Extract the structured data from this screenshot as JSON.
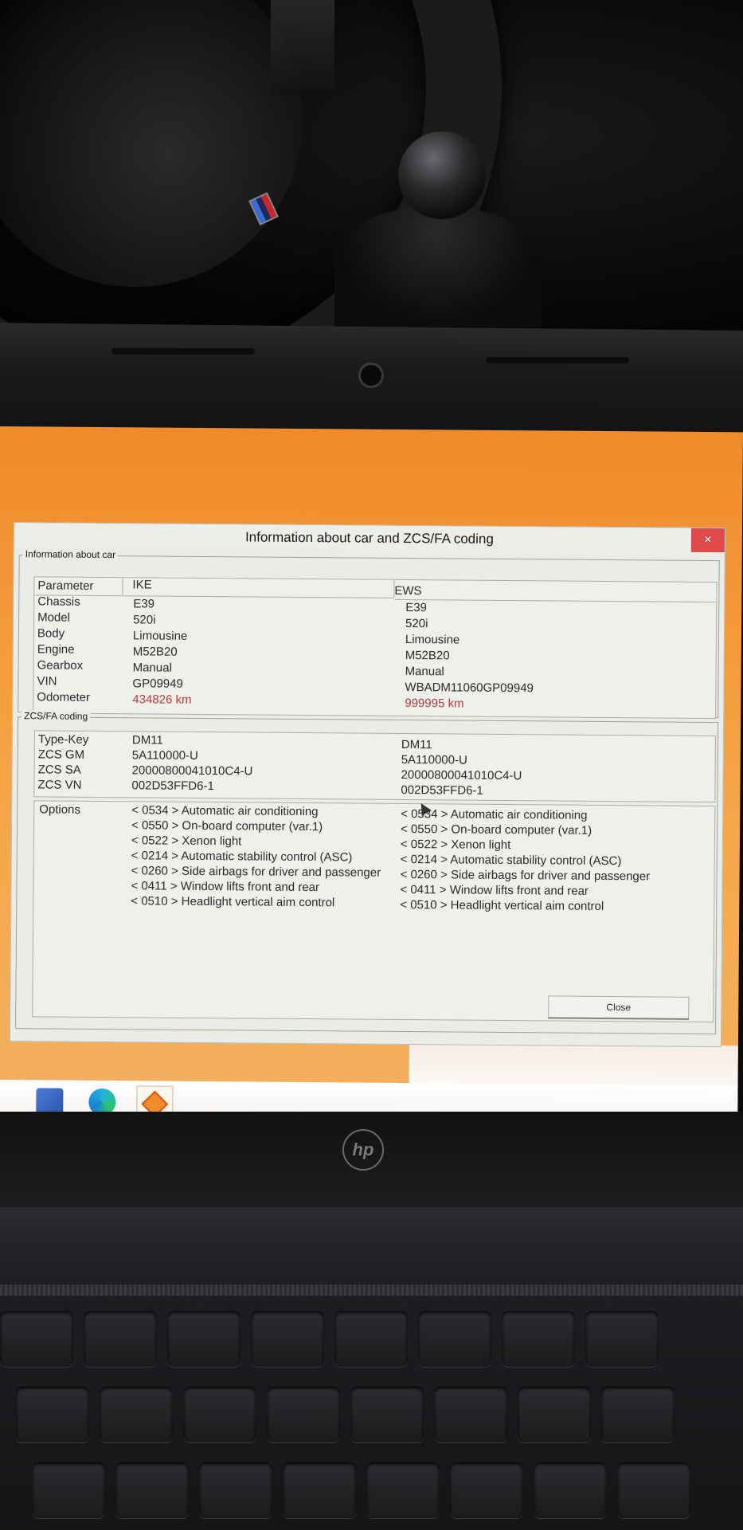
{
  "dialog": {
    "title": "Information about car and ZCS/FA coding",
    "close_icon": "×",
    "close_button_label": "Close",
    "info_group_title": "Information about car",
    "zcs_group_title": "ZCS/FA coding"
  },
  "info_table": {
    "headers": [
      "Parameter",
      "IKE",
      "EWS"
    ],
    "rows": [
      {
        "param": "Chassis",
        "ike": "E39",
        "ews": "E39"
      },
      {
        "param": "Model",
        "ike": "520i",
        "ews": "520i"
      },
      {
        "param": "Body",
        "ike": "Limousine",
        "ews": "Limousine"
      },
      {
        "param": "Engine",
        "ike": "M52B20",
        "ews": "M52B20"
      },
      {
        "param": "Gearbox",
        "ike": "Manual",
        "ews": "Manual"
      },
      {
        "param": "VIN",
        "ike": "GP09949",
        "ews": "WBADM11060GP09949"
      },
      {
        "param": "Odometer",
        "ike": "434826 km",
        "ews": "999995 km"
      }
    ]
  },
  "zcs_table": {
    "rows": [
      {
        "param": "Type-Key",
        "ike": "DM11",
        "ews": "DM11"
      },
      {
        "param": "ZCS GM",
        "ike": "5A110000-U",
        "ews": "5A110000-U"
      },
      {
        "param": "ZCS SA",
        "ike": "20000800041010C4-U",
        "ews": "20000800041010C4-U"
      },
      {
        "param": "ZCS VN",
        "ike": "002D53FFD6-1",
        "ews": "002D53FFD6-1"
      }
    ]
  },
  "options": {
    "label": "Options",
    "items": [
      "< 0534 >  Automatic air conditioning",
      "< 0550 >  On-board computer (var.1)",
      "< 0522 >  Xenon light",
      "< 0214 >  Automatic stability control (ASC)",
      "< 0260 >  Side airbags for driver and passenger",
      "< 0411 >  Window lifts front and rear",
      "< 0510 >  Headlight vertical aim control"
    ]
  },
  "laptop": {
    "brand_logo": "hp"
  },
  "colors": {
    "desktop_orange": "#f08a2a",
    "odometer_red": "#b73a3a",
    "close_red": "#e04a4a"
  }
}
